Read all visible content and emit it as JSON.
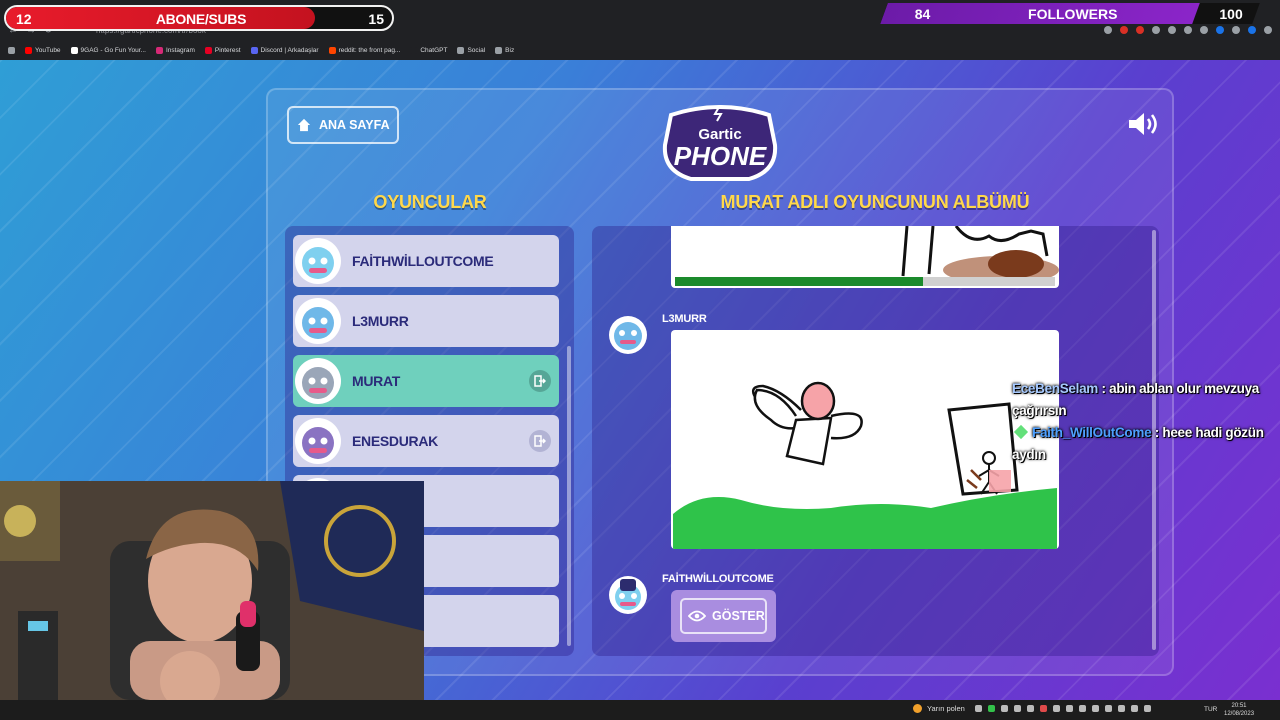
{
  "browser": {
    "url": "https://garticphone.com/tr/book",
    "bookmarks": [
      {
        "label": "YouTube",
        "color": "#ff0000"
      },
      {
        "label": "9GAG - Go Fun Your...",
        "color": "#ffffff"
      },
      {
        "label": "Instagram",
        "color": "#d62976"
      },
      {
        "label": "Pinterest",
        "color": "#e60023"
      },
      {
        "label": "Discord | Arkadaşlar",
        "color": "#5865f2"
      },
      {
        "label": "reddit: the front pag...",
        "color": "#ff4500"
      },
      {
        "label": "ChatGPT",
        "color": "#202124"
      },
      {
        "label": "Social",
        "color": "#9aa0a6"
      },
      {
        "label": "Biz",
        "color": "#9aa0a6"
      }
    ]
  },
  "overlay": {
    "subs": {
      "current": "12",
      "label": "ABONE/SUBS",
      "goal": "15",
      "progress_fraction": 0.8,
      "color": "#e81b2b"
    },
    "followers": {
      "current": "84",
      "label": "FOLLOWERS",
      "goal": "100",
      "progress_fraction": 0.84,
      "color": "#8b25c9"
    }
  },
  "game": {
    "home_label": "ANA SAYFA",
    "logo_text_top": "Gartic",
    "logo_text_bottom": "PHONE",
    "players_title": "OYUNCULAR",
    "album_title": "MURAT ADLI OYUNCUNUN ALBÜMÜ",
    "players": [
      {
        "name": "FAİTHWİLLOUTCOME",
        "active": false,
        "kick": false
      },
      {
        "name": "L3MURR",
        "active": false,
        "kick": false
      },
      {
        "name": "MURAT",
        "active": true,
        "kick": true
      },
      {
        "name": "ENESDURAK",
        "active": false,
        "kick": true
      },
      {
        "name": "",
        "active": false,
        "kick": false
      },
      {
        "name": "",
        "active": false,
        "kick": false
      },
      {
        "name": "",
        "active": false,
        "kick": false
      }
    ],
    "album": {
      "entry1_author": "L3MURR",
      "entry2_author": "FAİTHWİLLOUTCOME",
      "show_label": "GÖSTER"
    },
    "colors": {
      "title": "#ffd84a",
      "active_player": "#6fd0bd",
      "player": "#d3d4ec",
      "grass": "#2fc34a"
    }
  },
  "chat": [
    {
      "user": "EceBenSelam",
      "message": "abin ablan olur mevzuya çağrırsın"
    },
    {
      "user": "Faith_WillOutCome",
      "message": "heee hadi gözün aydın"
    }
  ],
  "taskbar": {
    "weather": "Yarın polen",
    "lang": "TUR",
    "time": "20:51",
    "date": "12/08/2023"
  }
}
